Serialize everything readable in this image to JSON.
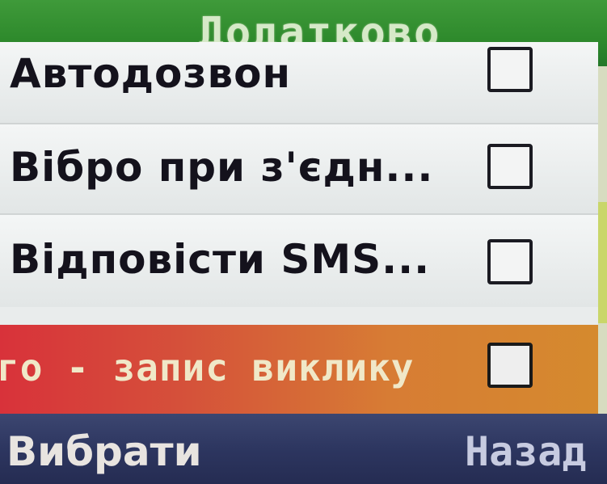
{
  "header": {
    "title": "Додатково"
  },
  "menu": {
    "items": [
      {
        "label": "Автодозвон",
        "checked": false,
        "selected": false
      },
      {
        "label": "Вібро при з'єдн...",
        "checked": false,
        "selected": false
      },
      {
        "label": "Відповісти SMS...",
        "checked": false,
        "selected": false
      },
      {
        "label": "го - запис виклику",
        "checked": false,
        "selected": true
      }
    ]
  },
  "softkeys": {
    "left": "Вибрати",
    "right": "Назад"
  },
  "colors": {
    "title_bar": "#2e8a2c",
    "selection": "#d8323a",
    "softkey_bar": "#2d3660",
    "scroll_thumb": "#c9d66a"
  },
  "scroll": {
    "position_fraction": 0.6
  }
}
